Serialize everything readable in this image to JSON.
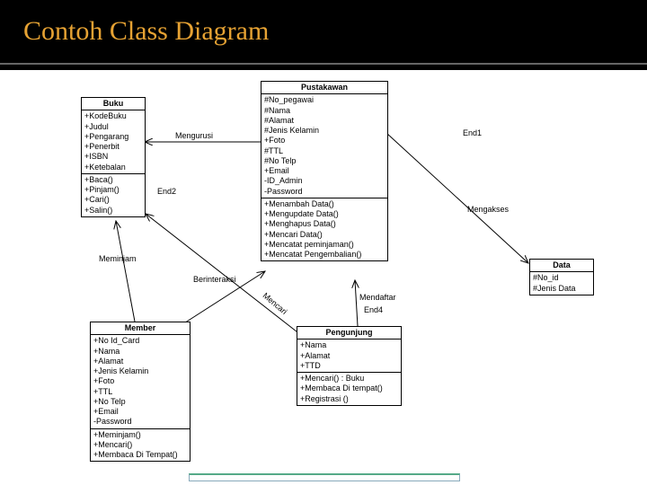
{
  "header": {
    "title": "Contoh Class Diagram"
  },
  "classes": {
    "buku": {
      "name": "Buku",
      "attrs": [
        "+KodeBuku",
        "+Judul",
        "+Pengarang",
        "+Penerbit",
        "+ISBN",
        "+Ketebalan"
      ],
      "ops": [
        "+Baca()",
        "+Pinjam()",
        "+Cari()",
        "+Salin()"
      ]
    },
    "pustakawan": {
      "name": "Pustakawan",
      "attrs": [
        "#No_pegawai",
        "#Nama",
        "#Alamat",
        "#Jenis Kelamin",
        "+Foto",
        "#TTL",
        "#No Telp",
        "+Email",
        "-ID_Admin",
        "-Password"
      ],
      "ops": [
        "+Menambah Data()",
        "+Mengupdate Data()",
        "+Menghapus Data()",
        "+Mencari Data()",
        "+Mencatat peminjaman()",
        "+Mencatat Pengembalian()"
      ]
    },
    "member": {
      "name": "Member",
      "attrs": [
        "+No Id_Card",
        "+Nama",
        "+Alamat",
        "+Jenis Kelamin",
        "+Foto",
        "+TTL",
        "+No Telp",
        "+Email",
        "-Password"
      ],
      "ops": [
        "+Meminjam()",
        "+Mencari()",
        "+Membaca Di Tempat()"
      ]
    },
    "pengunjung": {
      "name": "Pengunjung",
      "attrs": [
        "+Nama",
        "+Alamat",
        "+TTD"
      ],
      "ops": [
        "+Mencari() : Buku",
        "+Membaca Di tempat()",
        "+Registrasi ()"
      ]
    },
    "data": {
      "name": "Data",
      "attrs": [
        "#No_id",
        "#Jenis Data"
      ],
      "ops": []
    }
  },
  "labels": {
    "mengurusi": "Mengurusi",
    "end1": "End1",
    "end2": "End2",
    "mengakses": "Mengakses",
    "meminjam": "Meminjam",
    "berinteraksi": "Berinteraksi",
    "mencari": "Mencari",
    "mendaftar": "Mendaftar",
    "end4": "End4"
  }
}
